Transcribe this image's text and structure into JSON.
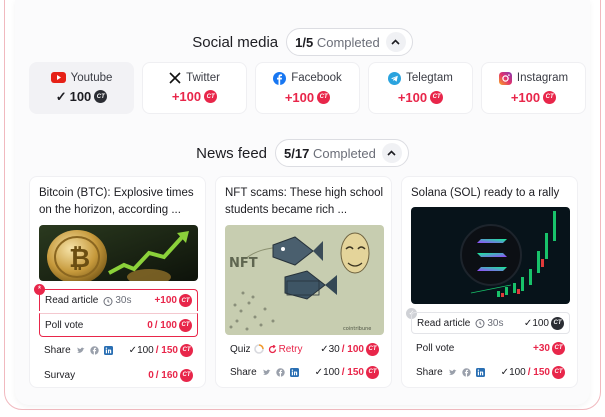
{
  "social": {
    "title": "Social media",
    "progress_done": "1/5",
    "progress_label": "Completed",
    "items": [
      {
        "name": "Youtube",
        "reward": "100",
        "completed": true
      },
      {
        "name": "Twitter",
        "reward": "+100",
        "completed": false
      },
      {
        "name": "Facebook",
        "reward": "+100",
        "completed": false
      },
      {
        "name": "Telegtam",
        "reward": "+100",
        "completed": false
      },
      {
        "name": "Instagram",
        "reward": "+100",
        "completed": false
      }
    ],
    "coin_text": "CT",
    "check_mark": "✓"
  },
  "news": {
    "title": "News feed",
    "progress_done": "5/17",
    "progress_label": "Completed",
    "cards": [
      {
        "title": "Bitcoin (BTC): Explosive times on the horizon, according ...",
        "image_caption": "",
        "read_label": "Read article",
        "read_time": "30s",
        "read_reward": "+100",
        "poll_label": "Poll vote",
        "poll_done": "0",
        "poll_total": "/ 100",
        "share_label": "Share",
        "share_done": "100",
        "share_total": "/ 150",
        "survey_label": "Survay",
        "survey_done": "0",
        "survey_total": "/ 160",
        "flag": "*"
      },
      {
        "title": "NFT scams: These high school students became rich ...",
        "image_caption": "NFT",
        "image_watermark": "cointribune",
        "quiz_label": "Quiz",
        "quiz_retry": "Retry",
        "quiz_done": "30",
        "quiz_total": "/ 100",
        "share_label": "Share",
        "share_done": "100",
        "share_total": "/ 150"
      },
      {
        "title": "Solana (SOL) ready to a rally",
        "read_label": "Read article",
        "read_time": "30s",
        "read_reward": "100",
        "poll_label": "Poll vote",
        "poll_reward": "+30",
        "share_label": "Share",
        "share_done": "100",
        "share_total": "/ 150"
      }
    ]
  },
  "colors": {
    "accent": "#e8264a",
    "panel": "#fbfbfc",
    "frame": "#f1b9bf"
  }
}
